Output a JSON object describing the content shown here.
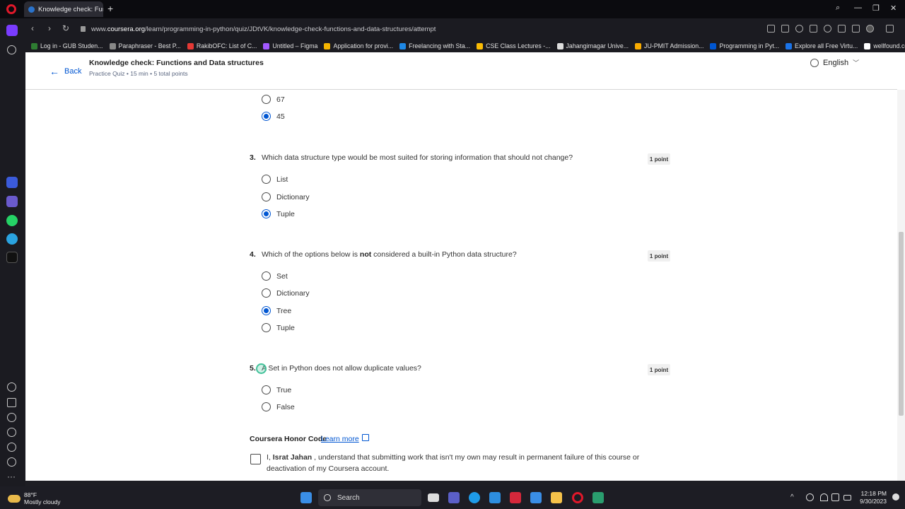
{
  "browser": {
    "tab_title": "Knowledge check: Functio",
    "url_prefix": "www.",
    "url_domain": "coursera.org",
    "url_path": "/learn/programming-in-python/quiz/JDtVK/knowledge-check-functions-and-data-structures/attempt",
    "bookmarks": [
      {
        "label": "Log in - GUB Studen...",
        "color": "#2e7d32"
      },
      {
        "label": "Paraphraser - Best P...",
        "color": "#888888"
      },
      {
        "label": "RakibOFC: List of C...",
        "color": "#e53935"
      },
      {
        "label": "Untitled – Figma",
        "color": "#a259ff"
      },
      {
        "label": "Application for provi...",
        "color": "#f4b400"
      },
      {
        "label": "Freelancing with Sta...",
        "color": "#1e88e5"
      },
      {
        "label": "CSE Class Lectures -...",
        "color": "#fbbc04"
      },
      {
        "label": "Jahangirnagar Unive...",
        "color": "#dddddd"
      },
      {
        "label": "JU-PMIT Admission...",
        "color": "#f9ab00"
      },
      {
        "label": "Programming in Pyt...",
        "color": "#0056d2"
      },
      {
        "label": "Explore all Free Virtu...",
        "color": "#1a73e8"
      },
      {
        "label": "wellfound.com/jobs/...",
        "color": "#ffffff"
      }
    ]
  },
  "header": {
    "back_label": "Back",
    "title": "Knowledge check: Functions and Data structures",
    "subtitle": "Practice Quiz • 15 min • 5 total points",
    "language": "English"
  },
  "prev_options": [
    {
      "label": "67",
      "selected": false
    },
    {
      "label": "45",
      "selected": true
    }
  ],
  "questions": [
    {
      "number": "3.",
      "text": "Which data structure type would be most suited for storing information that should not change?",
      "points": "1 point",
      "options": [
        {
          "label": "List",
          "selected": false
        },
        {
          "label": "Dictionary",
          "selected": false
        },
        {
          "label": "Tuple",
          "selected": true
        }
      ]
    },
    {
      "number": "4.",
      "text_before": "Which of the options below is ",
      "text_bold": "not",
      "text_after": " considered a built-in Python data structure?",
      "points": "1 point",
      "options": [
        {
          "label": "Set",
          "selected": false
        },
        {
          "label": "Dictionary",
          "selected": false
        },
        {
          "label": "Tree",
          "selected": true
        },
        {
          "label": "Tuple",
          "selected": false
        }
      ]
    },
    {
      "number": "5.",
      "text": "A Set in Python does not allow duplicate values?",
      "points": "1 point",
      "options": [
        {
          "label": "True",
          "selected": false
        },
        {
          "label": "False",
          "selected": false
        }
      ]
    }
  ],
  "honor_code": {
    "title": "Coursera Honor Code",
    "link": "Learn more",
    "text_before": "I, ",
    "name": "Israt Jahan",
    "text_after": " , understand that submitting work that isn't my own may result in permanent failure of this course or deactivation of my Coursera account."
  },
  "taskbar": {
    "temperature": "88°F",
    "weather": "Mostly cloudy",
    "search_label": "Search",
    "time": "12:18 PM",
    "date": "9/30/2023"
  }
}
